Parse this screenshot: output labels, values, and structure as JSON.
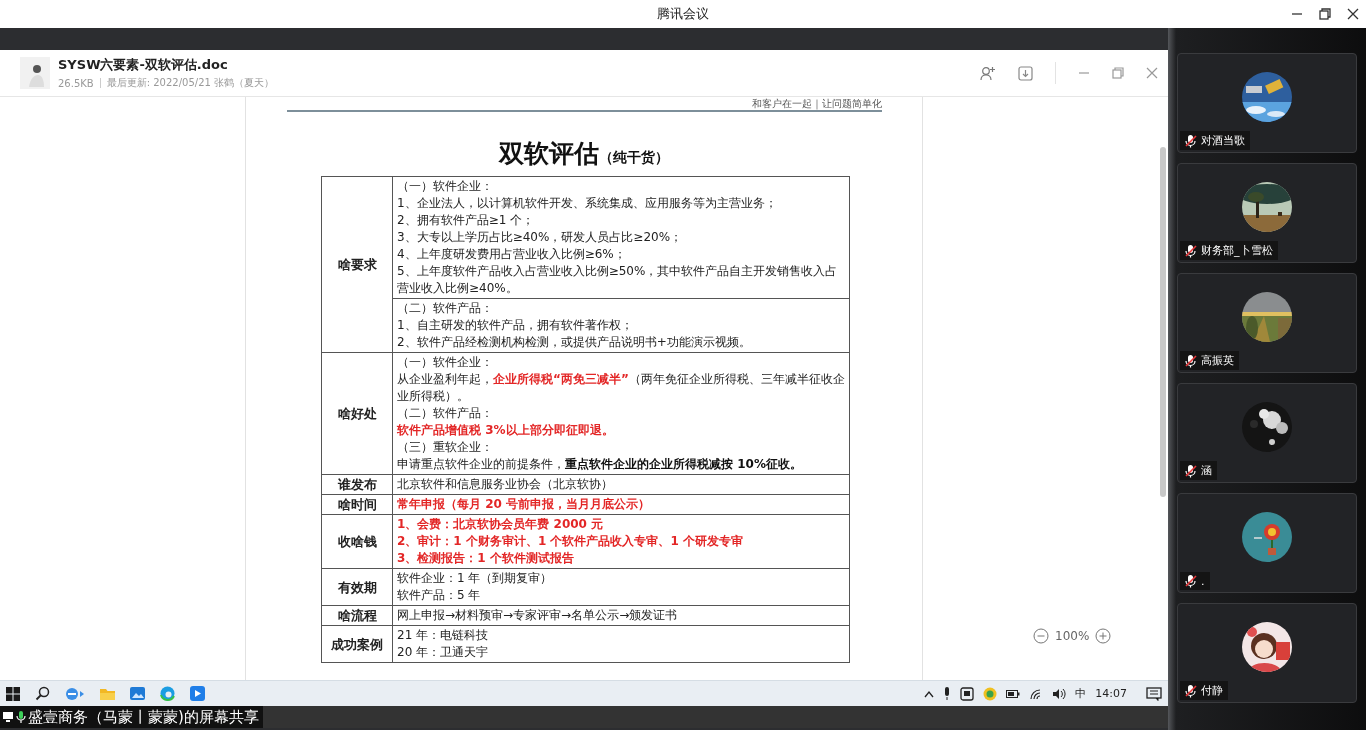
{
  "window": {
    "title": "腾讯会议"
  },
  "document": {
    "filename": "SYSW六要素-双软评估.doc",
    "size": "26.5KB",
    "updated": "最后更新: 2022/05/21 张鹤（夏天）",
    "slogan": "和客户在一起｜让问题简单化",
    "title": "双软评估",
    "subtitle": "（纯干货）",
    "zoom": "100%",
    "rows": [
      {
        "label": "啥要求",
        "cells": [
          {
            "lines": [
              {
                "parts": [
                  {
                    "text": "（一）软件企业：",
                    "kind": "plain"
                  }
                ]
              },
              {
                "parts": [
                  {
                    "text": "1、企业法人，以计算机软件开发、系统集成、应用服务等为主营业务；",
                    "kind": "plain"
                  }
                ]
              },
              {
                "parts": [
                  {
                    "text": "2、拥有软件产品≥1 个；",
                    "kind": "plain"
                  }
                ]
              },
              {
                "parts": [
                  {
                    "text": "3、大专以上学历占比≥40%，研发人员占比≥20%；",
                    "kind": "plain"
                  }
                ]
              },
              {
                "parts": [
                  {
                    "text": "4、上年度研发费用占营业收入比例≥6%；",
                    "kind": "plain"
                  }
                ]
              },
              {
                "parts": [
                  {
                    "text": "5、上年度软件产品收入占营业收入比例≥50%，其中软件产品自主开发销售收入占营业收入比例≥40%。",
                    "kind": "plain"
                  }
                ]
              }
            ]
          },
          {
            "lines": [
              {
                "parts": [
                  {
                    "text": "（二）软件产品：",
                    "kind": "plain"
                  }
                ]
              },
              {
                "parts": [
                  {
                    "text": "1、自主研发的软件产品，拥有软件著作权；",
                    "kind": "plain"
                  }
                ]
              },
              {
                "parts": [
                  {
                    "text": "2、软件产品经检测机构检测，或提供产品说明书+功能演示视频。",
                    "kind": "plain"
                  }
                ]
              }
            ]
          }
        ]
      },
      {
        "label": "啥好处",
        "cells": [
          {
            "lines": [
              {
                "parts": [
                  {
                    "text": "（一）软件企业：",
                    "kind": "plain"
                  }
                ]
              },
              {
                "parts": [
                  {
                    "text": "从企业盈利年起，",
                    "kind": "plain"
                  },
                  {
                    "text": "企业所得税“两免三减半”",
                    "kind": "red"
                  },
                  {
                    "text": "（两年免征企业所得税、三年减半征收企业所得税）。",
                    "kind": "plain"
                  }
                ]
              },
              {
                "parts": [
                  {
                    "text": "（二）软件产品：",
                    "kind": "plain"
                  }
                ]
              },
              {
                "parts": [
                  {
                    "text": "软件产品增值税 3%以上部分即征即退。",
                    "kind": "red"
                  }
                ]
              },
              {
                "parts": [
                  {
                    "text": "（三）重软企业：",
                    "kind": "plain"
                  }
                ]
              },
              {
                "parts": [
                  {
                    "text": "申请重点软件企业的前提条件，",
                    "kind": "plain"
                  },
                  {
                    "text": "重点软件企业的企业所得税减按 10%征收。",
                    "kind": "bold"
                  }
                ]
              }
            ]
          }
        ]
      },
      {
        "label": "谁发布",
        "cells": [
          {
            "lines": [
              {
                "parts": [
                  {
                    "text": "北京软件和信息服务业协会（北京软协）",
                    "kind": "plain"
                  }
                ]
              }
            ]
          }
        ]
      },
      {
        "label": "啥时间",
        "cells": [
          {
            "lines": [
              {
                "parts": [
                  {
                    "text": "常年申报（每月 20 号前申报，当月月底公示）",
                    "kind": "red"
                  }
                ]
              }
            ]
          }
        ]
      },
      {
        "label": "收啥钱",
        "cells": [
          {
            "lines": [
              {
                "parts": [
                  {
                    "text": "1、会费：北京软协会员年费 2000 元",
                    "kind": "red"
                  }
                ]
              },
              {
                "parts": [
                  {
                    "text": "2、审计：1 个财务审计、1 个软件产品收入专审、1 个研发专审",
                    "kind": "red"
                  }
                ]
              },
              {
                "parts": [
                  {
                    "text": "3、检测报告：1 个软件测试报告",
                    "kind": "red"
                  }
                ]
              }
            ]
          }
        ]
      },
      {
        "label": "有效期",
        "cells": [
          {
            "lines": [
              {
                "parts": [
                  {
                    "text": "软件企业：1 年（到期复审）",
                    "kind": "plain"
                  }
                ]
              },
              {
                "parts": [
                  {
                    "text": "软件产品：5 年",
                    "kind": "plain"
                  }
                ]
              }
            ]
          }
        ]
      },
      {
        "label": "啥流程",
        "cells": [
          {
            "lines": [
              {
                "parts": [
                  {
                    "text": "网上申报→材料预审→专家评审→名单公示→颁发证书",
                    "kind": "plain"
                  }
                ]
              }
            ]
          }
        ]
      },
      {
        "label": "成功案例",
        "cells": [
          {
            "lines": [
              {
                "parts": [
                  {
                    "text": "21 年：电链科技",
                    "kind": "plain"
                  }
                ]
              },
              {
                "parts": [
                  {
                    "text": "20 年：卫通天宇",
                    "kind": "plain"
                  }
                ]
              }
            ]
          }
        ]
      }
    ]
  },
  "taskbar": {
    "input_method": "中",
    "time": "14:07"
  },
  "share_banner": "盛壹商务（马蒙丨蒙蒙)的屏幕共享",
  "participants": [
    {
      "name": "对酒当歌",
      "muted": true
    },
    {
      "name": "财务部_卜雪松",
      "muted": true
    },
    {
      "name": "高振英",
      "muted": true
    },
    {
      "name": "涵",
      "muted": true
    },
    {
      "name": ".",
      "muted": true
    },
    {
      "name": "付静",
      "muted": true
    }
  ]
}
